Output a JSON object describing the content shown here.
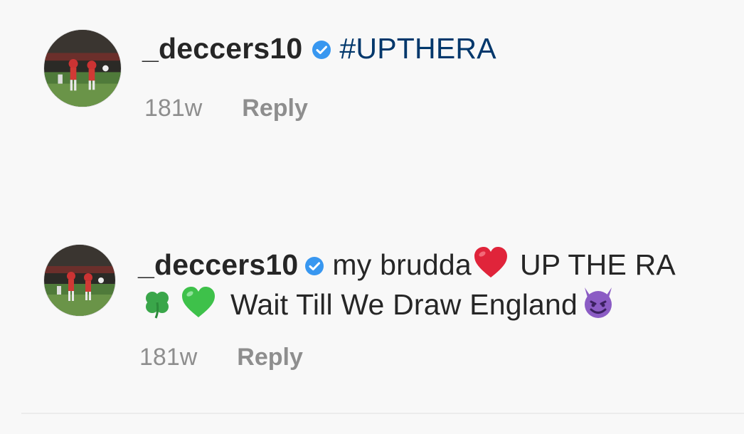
{
  "comments": [
    {
      "username": "_deccers10",
      "verified": true,
      "text_line1_hashtag": "#UPTHERA",
      "time": "181w",
      "reply_label": "Reply"
    },
    {
      "username": "_deccers10",
      "verified": true,
      "text_part1": "my brudda",
      "text_part2": "UP THE RA",
      "text_line2": "Wait Till We Draw England",
      "emojis": [
        "red-heart",
        "shamrock",
        "green-heart",
        "smiling-devil"
      ],
      "time": "181w",
      "reply_label": "Reply"
    }
  ],
  "colors": {
    "verified_badge": "#3897f0",
    "hashtag": "#00376b",
    "meta_text": "#8e8e8e",
    "heart_red": "#e0243a",
    "heart_green": "#3ec14a",
    "devil_purple": "#8b5cc4"
  }
}
